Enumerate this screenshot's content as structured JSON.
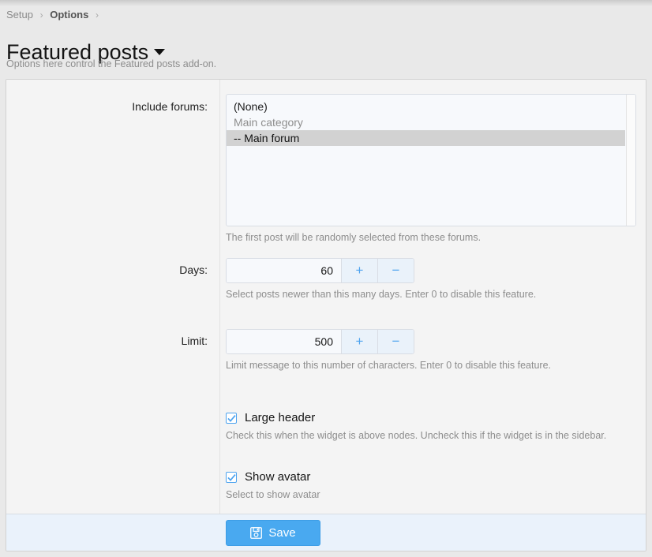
{
  "breadcrumb": {
    "items": [
      {
        "label": "Setup",
        "strong": false
      },
      {
        "label": "Options",
        "strong": true
      }
    ],
    "separator": "›"
  },
  "header": {
    "title": "Featured posts",
    "caret_icon": "caret-down-icon",
    "description": "Options here control the Featured posts add-on."
  },
  "form": {
    "include_forums": {
      "label": "Include forums:",
      "hint": "The first post will be randomly selected from these forums.",
      "options": [
        {
          "label": "(None)",
          "style": "normal",
          "selected": false
        },
        {
          "label": "Main category",
          "style": "group",
          "selected": false
        },
        {
          "label": "-- Main forum",
          "style": "normal",
          "selected": true
        }
      ]
    },
    "days": {
      "label": "Days:",
      "value": "60",
      "increment_label": "+",
      "decrement_label": "−",
      "hint": "Select posts newer than this many days. Enter 0 to disable this feature."
    },
    "limit": {
      "label": "Limit:",
      "value": "500",
      "increment_label": "+",
      "decrement_label": "−",
      "hint": "Limit message to this number of characters. Enter 0 to disable this feature."
    },
    "large_header": {
      "label": "Large header",
      "checked": true,
      "hint": "Check this when the widget is above nodes. Uncheck this if the widget is in the sidebar."
    },
    "show_avatar": {
      "label": "Show avatar",
      "checked": true,
      "hint": "Select to show avatar"
    }
  },
  "footer": {
    "save_label": "Save",
    "save_icon": "floppy-disk-icon"
  },
  "colors": {
    "accent": "#49a9f0",
    "spinner_glyph": "#4da3ef",
    "footer_bg": "#eaf2fb",
    "field_bg": "#f7f9fc",
    "selection_bg": "#d2d2d2",
    "page_bg": "#e9e9e9",
    "hint_text": "#8d8d8d"
  }
}
